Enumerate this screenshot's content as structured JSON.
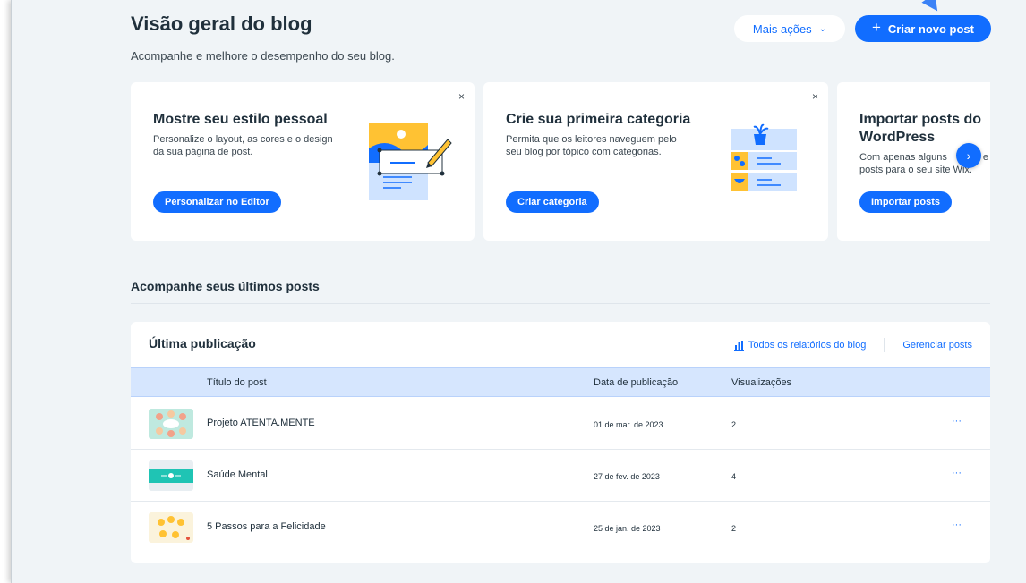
{
  "header": {
    "title": "Visão geral do blog",
    "subtitle": "Acompanhe e melhore o desempenho do seu blog.",
    "more_actions_label": "Mais ações",
    "create_post_label": "Criar novo post"
  },
  "cards": [
    {
      "title": "Mostre seu estilo pessoal",
      "description_lines": [
        "Personalize o layout, as cores e o design",
        "da sua página de post."
      ],
      "button_label": "Personalizar no Editor",
      "close_label": "×"
    },
    {
      "title": "Crie sua primeira categoria",
      "description_lines": [
        "Permita que os leitores naveguem pelo",
        "seu blog por tópico com categorias."
      ],
      "button_label": "Criar categoria",
      "close_label": "×"
    },
    {
      "title_lines": [
        "Importar posts do",
        "WordPress"
      ],
      "description_lines": [
        "Com apenas alguns",
        "posts para o seu site Wix."
      ],
      "description_tail": "e",
      "button_label": "Importar posts"
    }
  ],
  "carousel": {
    "next_icon": "›"
  },
  "section": {
    "title": "Acompanhe seus últimos posts"
  },
  "panel": {
    "title": "Última publicação",
    "reports_link": "Todos os relatórios do blog",
    "manage_link": "Gerenciar posts",
    "columns": [
      "Título do post",
      "Data de publicação",
      "Visualizações"
    ],
    "rows": [
      {
        "title": "Projeto ATENTA.MENTE",
        "date": "01 de mar. de 2023",
        "views": "2",
        "more": "···"
      },
      {
        "title": "Saúde Mental",
        "date": "27 de fev. de 2023",
        "views": "4",
        "more": "···"
      },
      {
        "title": "5 Passos para a Felicidade",
        "date": "25 de jan. de 2023",
        "views": "2",
        "more": "···"
      }
    ]
  },
  "colors": {
    "accent": "#116dff",
    "page_background": "#f0f4f7",
    "table_header": "#d6e6fe"
  }
}
